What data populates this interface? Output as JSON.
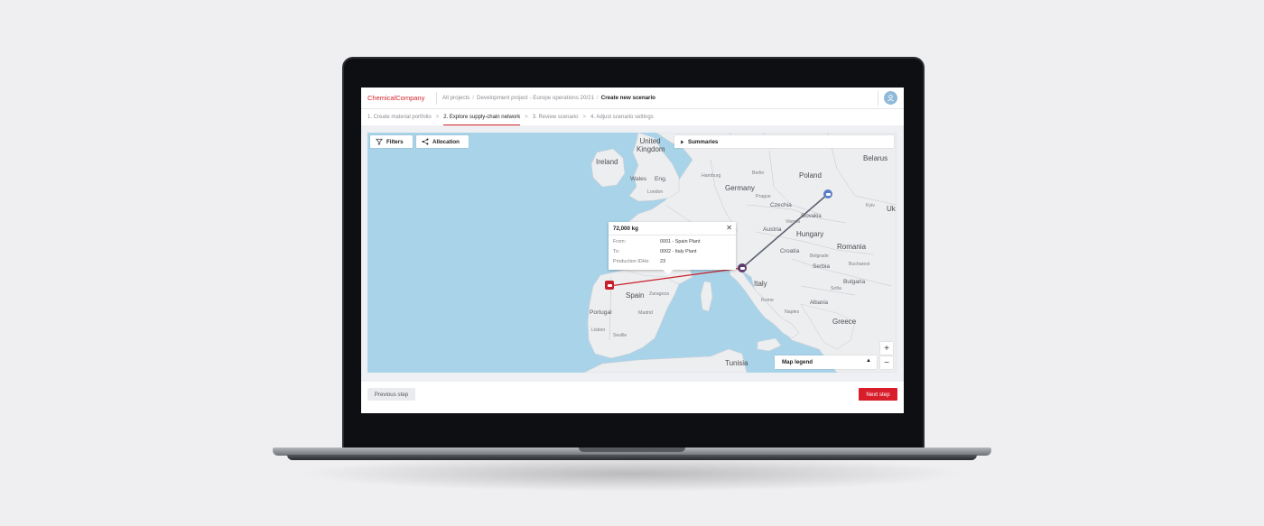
{
  "app": {
    "brand": "ChemicalCompany"
  },
  "breadcrumb": {
    "items": [
      "All projects",
      "Development project - Europe operations 20/21"
    ],
    "current": "Create new scenario",
    "separator": "/"
  },
  "steps": [
    {
      "label": "1. Create material portfolio"
    },
    {
      "label": "2. Explore supply-chain network"
    },
    {
      "label": "3. Review scenario"
    },
    {
      "label": "4. Adjust scenario settings"
    }
  ],
  "map": {
    "filters_label": "Filters",
    "allocation_label": "Allocation",
    "summaries_label": "Summaries",
    "legend_label": "Map legend",
    "zoom_in": "+",
    "zoom_out": "−",
    "countries": {
      "uk": "United Kingdom",
      "ireland": "Ireland",
      "wales": "Wales",
      "eng": "Eng.",
      "germany": "Germany",
      "poland": "Poland",
      "belarus": "Belarus",
      "czechia": "Czechia",
      "slovakia": "Slovakia",
      "austria": "Austria",
      "hungary": "Hungary",
      "romania": "Romania",
      "croatia": "Croatia",
      "serbia": "Serbia",
      "bulgaria": "Bulgaria",
      "italy": "Italy",
      "spain": "Spain",
      "portugal": "Portugal",
      "greece": "Greece",
      "tunisia": "Tunisia",
      "albania": "Albania",
      "ukraine": "Uk"
    },
    "cities": {
      "london": "London",
      "berlin": "Berlin",
      "hamburg": "Hamburg",
      "prague": "Prague",
      "vienna": "Vienna",
      "bucharest": "Bucharest",
      "sofia": "Sofia",
      "madrid": "Madrid",
      "lisbon": "Lisbon",
      "seville": "Seville",
      "rome": "Rome",
      "zaragoza": "Zaragoza",
      "belgrade": "Belgrade",
      "naples": "Naples",
      "kiev": "Kyiv"
    },
    "colors": {
      "origin_marker": "#c8202b",
      "destination_marker": "#5b3a6e",
      "third_marker": "#5a7fc6",
      "route_active": "#c8202b",
      "route_inactive": "#5d6270"
    },
    "popup": {
      "title": "72,000 kg",
      "close_icon": "close-icon",
      "rows": [
        {
          "key": "From:",
          "value": "0001 - Spain Plant"
        },
        {
          "key": "To:",
          "value": "0002 - Italy Plant"
        },
        {
          "key": "Production IDHs:",
          "value": "23"
        }
      ]
    }
  },
  "footer": {
    "prev_label": "Previous step",
    "next_label": "Next step"
  }
}
